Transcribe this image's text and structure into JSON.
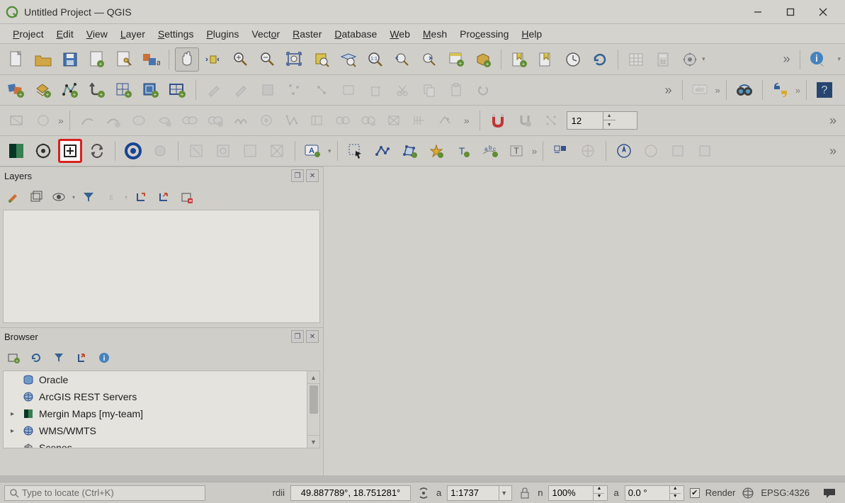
{
  "window": {
    "title": "Untitled Project — QGIS"
  },
  "menu": {
    "items": [
      "Project",
      "Edit",
      "View",
      "Layer",
      "Settings",
      "Plugins",
      "Vector",
      "Raster",
      "Database",
      "Web",
      "Mesh",
      "Processing",
      "Help"
    ]
  },
  "toolbar4_spin_value": "12",
  "panels": {
    "layers": {
      "title": "Layers"
    },
    "browser": {
      "title": "Browser",
      "items": [
        {
          "icon": "oracle",
          "label": "Oracle",
          "expandable": false
        },
        {
          "icon": "arcgis",
          "label": "ArcGIS REST Servers",
          "expandable": false
        },
        {
          "icon": "mergin",
          "label": "Mergin Maps [my-team]",
          "expandable": true
        },
        {
          "icon": "wms",
          "label": "WMS/WMTS",
          "expandable": true
        },
        {
          "icon": "scenes",
          "label": "Scenes",
          "expandable": false
        }
      ]
    }
  },
  "status": {
    "locate_placeholder": "Type to locate (Ctrl+K)",
    "coord_label": "rdii",
    "coord_value": "49.887789°, 18.751281°",
    "scale_label": "a",
    "scale_value": "1:1737",
    "mag_label": "n",
    "mag_value": "100%",
    "rot_label": "a",
    "rot_value": "0.0 °",
    "render_label": "Render",
    "crs_label": "EPSG:4326"
  }
}
